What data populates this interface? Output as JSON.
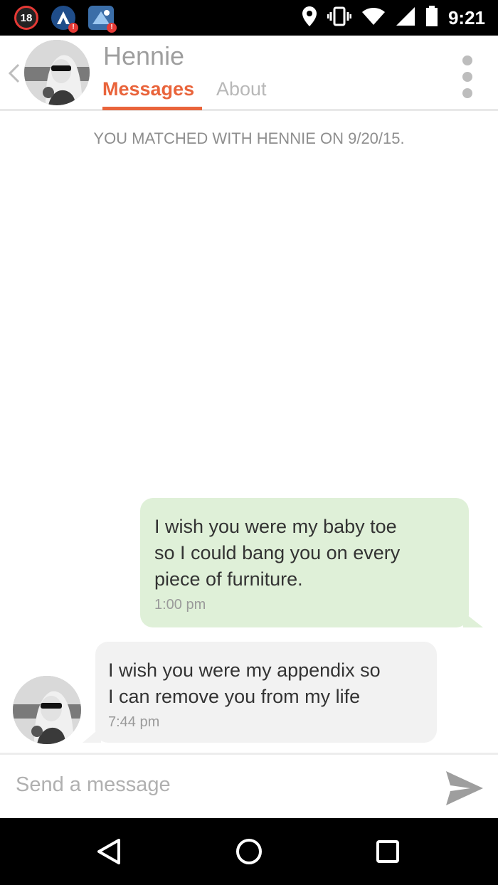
{
  "status_bar": {
    "notification_count": "18",
    "time": "9:21",
    "icons": [
      "notification-badge-icon",
      "app-a-icon",
      "app-b-icon",
      "location-icon",
      "vibrate-icon",
      "wifi-icon",
      "signal-icon",
      "battery-icon"
    ]
  },
  "header": {
    "name": "Hennie",
    "tabs": {
      "messages": "Messages",
      "about": "About"
    },
    "active_tab": "Messages"
  },
  "conversation": {
    "matched_notice": "YOU MATCHED WITH HENNIE ON 9/20/15.",
    "messages": [
      {
        "direction": "outgoing",
        "lines": [
          "I wish you were my baby toe",
          "so I could bang you on every",
          "piece of furniture."
        ],
        "time": "1:00 pm"
      },
      {
        "direction": "incoming",
        "lines": [
          "I wish you were my appendix so",
          "I can remove you from my life"
        ],
        "time": "7:44 pm"
      }
    ]
  },
  "composer": {
    "placeholder": "Send a message"
  },
  "colors": {
    "accent": "#e9643b",
    "outgoing_bubble": "#dff0d8",
    "incoming_bubble": "#f2f2f2",
    "status_bar": "#000000"
  }
}
